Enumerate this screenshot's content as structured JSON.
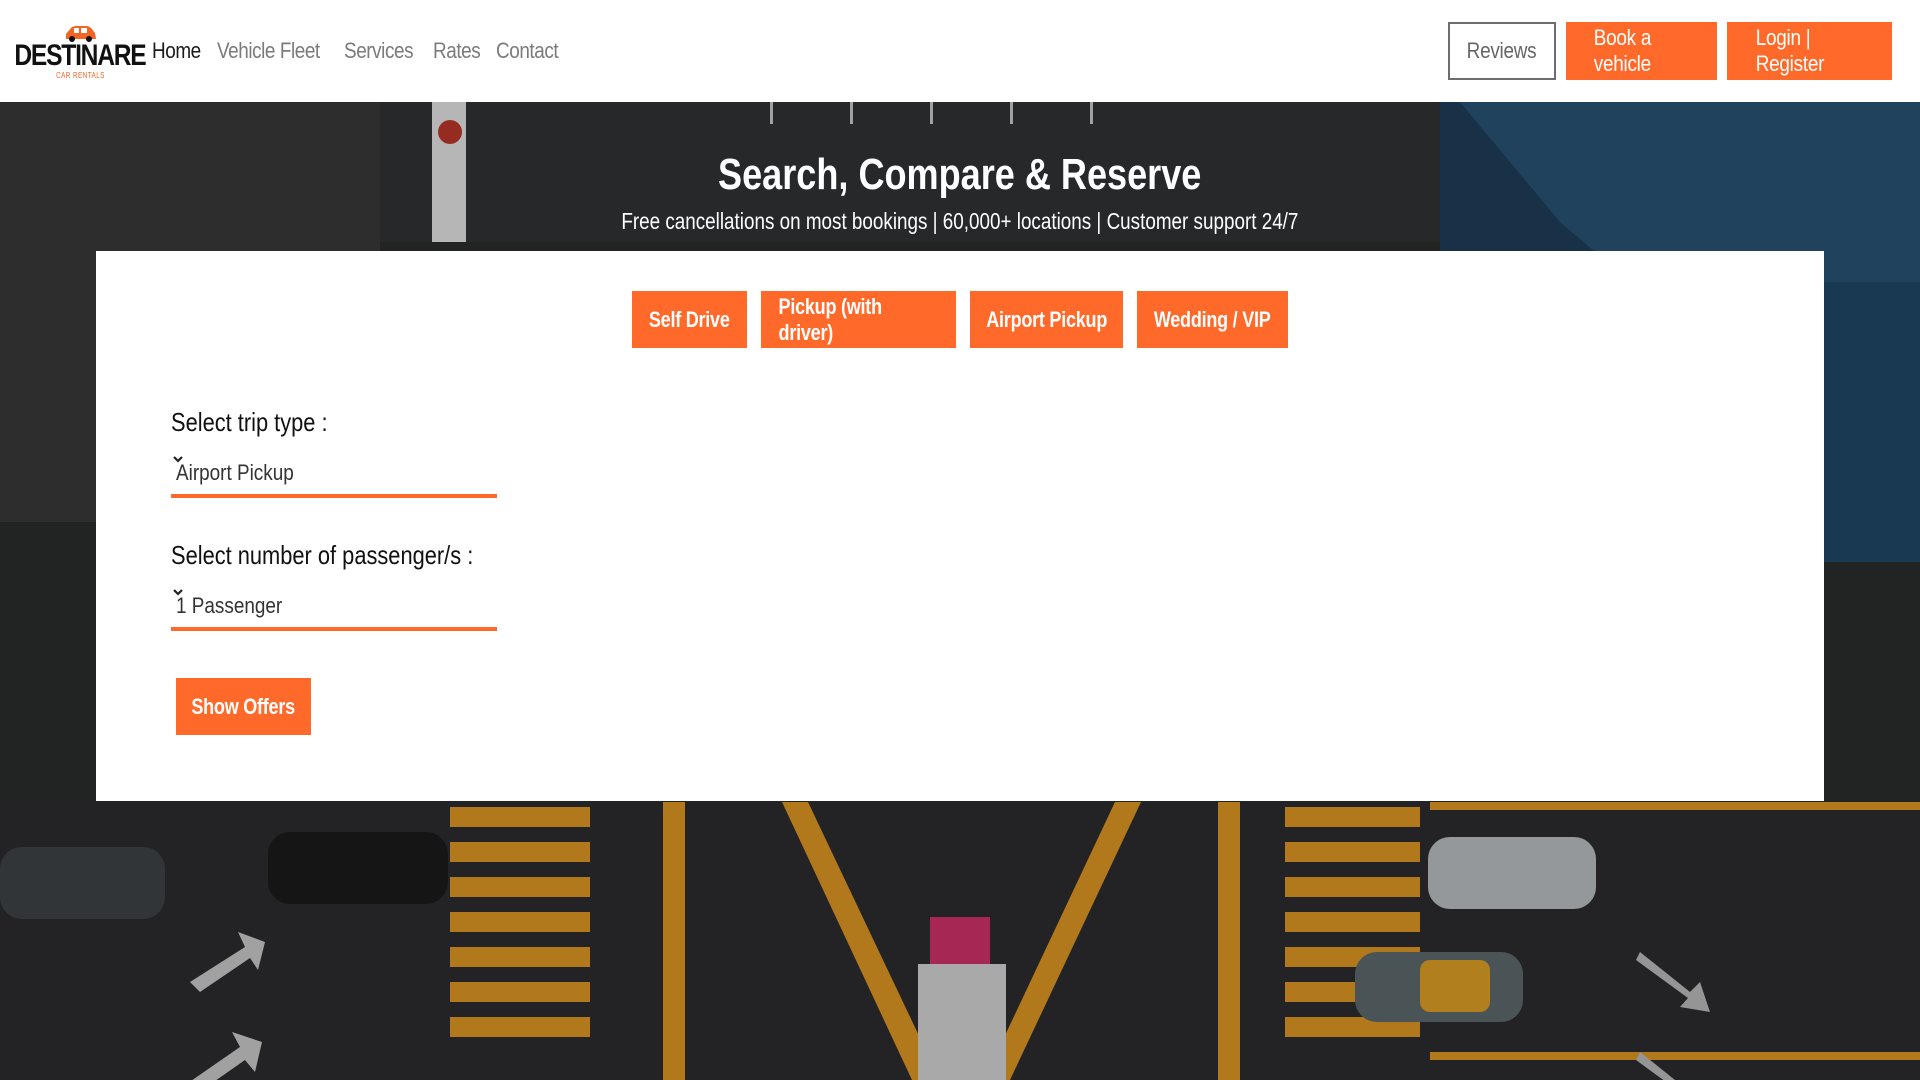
{
  "brand": {
    "name": "DESTINARE",
    "tagline": "CAR RENTALS",
    "accent_color": "#ff6a2b"
  },
  "nav": {
    "links": [
      {
        "label": "Home",
        "active": true
      },
      {
        "label": "Vehicle Fleet",
        "active": false
      },
      {
        "label": "Services",
        "active": false
      },
      {
        "label": "Rates",
        "active": false
      },
      {
        "label": "Contact",
        "active": false
      }
    ],
    "reviews_label": "Reviews",
    "book_label": "Book a vehicle",
    "login_label": "Login | Register"
  },
  "hero": {
    "title": "Search, Compare & Reserve",
    "subtitle": "Free cancellations on most bookings | 60,000+ locations | Customer support 24/7"
  },
  "search": {
    "trip_types": [
      "Self Drive",
      "Pickup (with driver)",
      "Airport Pickup",
      "Wedding / VIP"
    ],
    "trip_type_label": "Select trip type :",
    "trip_type_value": "Airport Pickup",
    "passengers_label": "Select number of passenger/s :",
    "passengers_value": "1 Passenger",
    "submit_label": "Show Offers"
  }
}
